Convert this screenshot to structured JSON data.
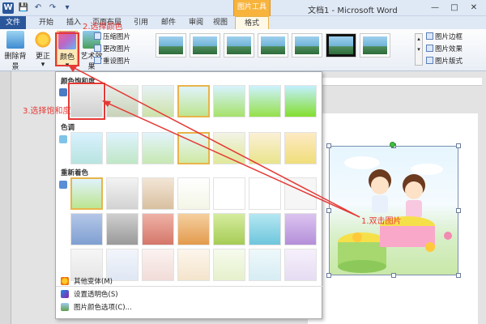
{
  "window": {
    "app_icon_letter": "W",
    "title": "文档1 - Microsoft Word",
    "context_tab_group": "图片工具",
    "win_buttons": [
      "—",
      "□",
      "✕"
    ]
  },
  "quick_access": [
    "💾",
    "↶",
    "↷",
    "▾"
  ],
  "tabs": [
    {
      "label": "文件"
    },
    {
      "label": "开始"
    },
    {
      "label": "插入"
    },
    {
      "label": "页面布局"
    },
    {
      "label": "引用"
    },
    {
      "label": "邮件"
    },
    {
      "label": "审阅"
    },
    {
      "label": "视图"
    },
    {
      "label": "格式"
    }
  ],
  "ribbon": {
    "remove_bg": "删除背景",
    "corrections": "更正",
    "color": "颜色",
    "artistic": "艺术效果",
    "compress": "压缩图片",
    "change": "更改图片",
    "reset": "重设图片",
    "border": "图片边框",
    "effects": "图片效果",
    "layout": "图片版式"
  },
  "panel": {
    "saturation_title": "颜色饱和度",
    "tone_title": "色调",
    "recolor_title": "重新着色",
    "more_variations": "其他变体(M)",
    "set_transparent": "设置透明色(S)",
    "color_options": "图片颜色选项(C)..."
  },
  "annotations": {
    "step1": "1.双击图片",
    "step2": "2.选择颜色",
    "step3": "3.选择饱和度"
  },
  "colors": {
    "annotation": "#e53935",
    "selection": "#e8b44a",
    "word_blue": "#2b579a",
    "context_orange": "#f7b33c"
  }
}
